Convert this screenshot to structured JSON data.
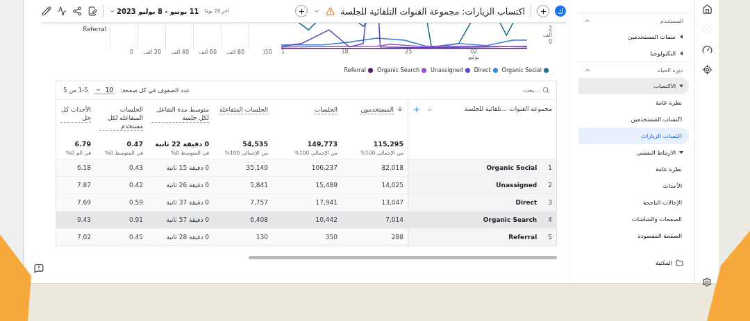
{
  "topbar": {
    "avatar": "ك",
    "title": "اكتساب الزيارات: مجموعة القنوات التلقائية للجلسة",
    "date_hint": "آخر 28 يومًا",
    "date_range": "11 يونيو - 8 يوليو 2023"
  },
  "bar_axis": {
    "category": "Referral",
    "ticks": [
      "10(",
      "80 ألف",
      "60 ألف",
      "40 ألف",
      "20 ألف",
      "0"
    ]
  },
  "line_axis": {
    "y_ticks": [
      "2 ألف",
      "0"
    ],
    "x_ticks": [
      {
        "label": "02",
        "sub": "يوليو"
      },
      {
        "label": "25"
      },
      {
        "label": "18"
      },
      {
        "label": "1"
      }
    ]
  },
  "legend": [
    {
      "label": "Organic Social",
      "color": "#1f6f8b"
    },
    {
      "label": "Direct",
      "color": "#3f83d6"
    },
    {
      "label": "Unassigned",
      "color": "#5b4bb8"
    },
    {
      "label": "Organic Search",
      "color": "#9b4fc4"
    },
    {
      "label": "Referral",
      "color": "#5a1a6e"
    }
  ],
  "table": {
    "search_placeholder": "بحث...",
    "rows_per_page_label": "عدد الصفوف في كل صفحة:",
    "rows_per_page": "10",
    "pagination": "1-5 من 5",
    "dimension": "مجموعة القنوات ...تلقائية للجلسة",
    "columns": [
      {
        "label": "المستخدمون",
        "sorted": true,
        "total": "115,295",
        "note": "من الإجمالي 100%"
      },
      {
        "label": "الجلسات",
        "sorted": false,
        "total": "149,773",
        "note": "من الإجمالي 100%"
      },
      {
        "label": "الجلسات المتفاعلة",
        "sorted": false,
        "total": "54,535",
        "note": "من الإجمالي 100%"
      },
      {
        "label": "متوسط مدة التفاعل لكل جلسة",
        "sorted": false,
        "total": "0 دقيقة 22 ثانية",
        "note": "في المتوسط 0%"
      },
      {
        "label": "الجلسات المتفاعلة لكل مستخدم",
        "sorted": false,
        "total": "0.47",
        "note": "في المتوسط 0%"
      },
      {
        "label": "الأحداث كل جل",
        "sorted": false,
        "total": "6.79",
        "note": "في الم 0%"
      }
    ],
    "rows": [
      {
        "rank": "1",
        "name": "Organic Social",
        "selected": false,
        "values": [
          "82,018",
          "106,237",
          "35,149",
          "0 دقيقة 15 ثانية",
          "0.43",
          "6.18"
        ]
      },
      {
        "rank": "2",
        "name": "Unassigned",
        "selected": false,
        "values": [
          "14,025",
          "15,489",
          "5,841",
          "0 دقيقة 26 ثانية",
          "0.42",
          "7.87"
        ]
      },
      {
        "rank": "3",
        "name": "Direct",
        "selected": false,
        "values": [
          "13,047",
          "17,941",
          "7,757",
          "0 دقيقة 37 ثانية",
          "0.59",
          "7.69"
        ]
      },
      {
        "rank": "4",
        "name": "Organic Search",
        "selected": true,
        "values": [
          "7,014",
          "10,442",
          "6,408",
          "0 دقيقة 57 ثانية",
          "0.91",
          "9.43"
        ]
      },
      {
        "rank": "5",
        "name": "Referral",
        "selected": false,
        "values": [
          "288",
          "350",
          "130",
          "0 دقيقة 28 ثانية",
          "0.45",
          "7.02"
        ]
      }
    ]
  },
  "sidebar": {
    "sections": [
      {
        "title": "المستخدم",
        "expanded": true,
        "items": [
          {
            "label": "سمات المستخدمين",
            "expanded": false
          },
          {
            "label": "التكنولوجيا",
            "expanded": false
          }
        ]
      },
      {
        "title": "دورة الحياة",
        "expanded": true,
        "items": [
          {
            "label": "الاكتساب",
            "expanded": true,
            "children": [
              {
                "label": "نظرة عامة",
                "selected": false
              },
              {
                "label": "اكتساب المستخدمين",
                "selected": false
              },
              {
                "label": "اكتساب الزيارات",
                "selected": true
              }
            ]
          },
          {
            "label": "الارتباط النفسي",
            "expanded": true,
            "children": [
              {
                "label": "نظرة عامة",
                "selected": false
              },
              {
                "label": "الأحداث",
                "selected": false
              },
              {
                "label": "الإحالات الناجحة",
                "selected": false
              },
              {
                "label": "الصفحات والشاشات",
                "selected": false
              },
              {
                "label": "الصفحة المقصودة",
                "selected": false
              }
            ]
          }
        ]
      }
    ],
    "library": "المكتبة"
  }
}
